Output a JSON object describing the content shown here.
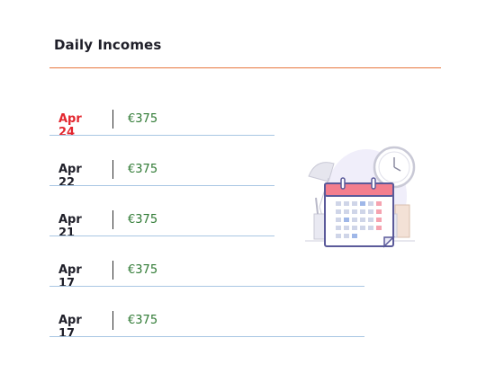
{
  "panel": {
    "title": "Daily Incomes"
  },
  "incomes": [
    {
      "date": "Apr 24",
      "amount": "€375",
      "highlight": true
    },
    {
      "date": "Apr 22",
      "amount": "€375",
      "highlight": false
    },
    {
      "date": "Apr 21",
      "amount": "€375",
      "highlight": false
    },
    {
      "date": "Apr 17",
      "amount": "€375",
      "highlight": false
    },
    {
      "date": "Apr 17",
      "amount": "€375",
      "highlight": false
    }
  ],
  "colors": {
    "accent_rule": "#e8773e",
    "highlight_date": "#e3262e",
    "amount": "#2f7a34",
    "row_divider": "#a9c7e3"
  },
  "illustration": {
    "icon": "calendar-clock-illustration-icon"
  }
}
